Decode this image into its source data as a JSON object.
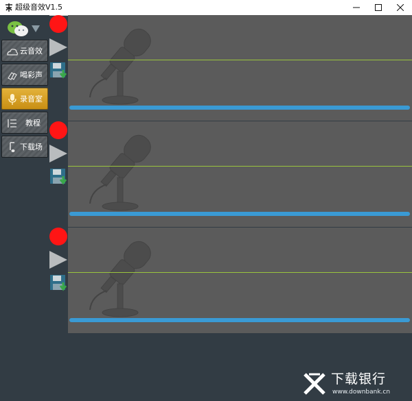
{
  "window": {
    "title": "超级音效V1.5"
  },
  "sidebar": {
    "wechat_icon": "wechat-icon",
    "items": [
      {
        "label": "云音效",
        "icon": "cloud-icon",
        "active": false
      },
      {
        "label": "喝彩声",
        "icon": "applause-icon",
        "active": false
      },
      {
        "label": "录音室",
        "icon": "microphone-icon",
        "active": true
      },
      {
        "label": "教程",
        "icon": "list-icon",
        "active": false
      },
      {
        "label": "下载场",
        "icon": "music-note-icon",
        "active": false
      }
    ]
  },
  "tracks": [
    {
      "record": "record-icon",
      "play": "play-icon",
      "save": "save-icon"
    },
    {
      "record": "record-icon",
      "play": "play-icon",
      "save": "save-icon"
    },
    {
      "record": "record-icon",
      "play": "play-icon",
      "save": "save-icon"
    }
  ],
  "colors": {
    "record": "#ff1515",
    "active_tab": "#e0a528",
    "waveform_line": "#9bc53d",
    "progress": "#3a9ad4"
  },
  "watermark": {
    "text": "下载银行",
    "url": "www.downbank.cn"
  }
}
